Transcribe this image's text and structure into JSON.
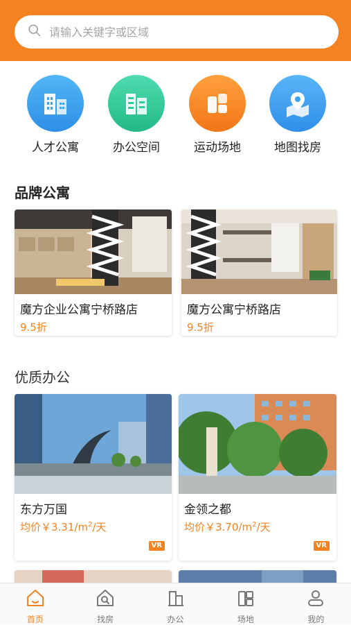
{
  "search": {
    "placeholder": "请输入关键字或区域"
  },
  "categories": [
    {
      "label": "人才公寓",
      "icon": "apartment-building-icon",
      "color": "#3ba4ee"
    },
    {
      "label": "办公空间",
      "icon": "office-building-icon",
      "color": "#2ecc9a"
    },
    {
      "label": "运动场地",
      "icon": "sports-venue-icon",
      "color": "#f58220"
    },
    {
      "label": "地图找房",
      "icon": "map-pin-icon",
      "color": "#3b9ff0"
    }
  ],
  "brand_section": {
    "title": "品牌公寓",
    "cards": [
      {
        "name": "魔方企业公寓宁桥路店",
        "price": "9.5折"
      },
      {
        "name": "魔方公寓宁桥路店",
        "price": "9.5折"
      }
    ]
  },
  "office_section": {
    "title": "优质办公",
    "cards": [
      {
        "name": "东方万国",
        "price_prefix": "均价￥3.31/m",
        "price_sup": "2",
        "price_suffix": "/天",
        "badge": "VR"
      },
      {
        "name": "金领之都",
        "price_prefix": "均价￥3.70/m",
        "price_sup": "2",
        "price_suffix": "/天",
        "badge": "VR"
      }
    ]
  },
  "bottom_nav": [
    {
      "label": "首页",
      "icon": "home-icon",
      "active": true
    },
    {
      "label": "找房",
      "icon": "find-house-icon",
      "active": false
    },
    {
      "label": "办公",
      "icon": "office-icon",
      "active": false
    },
    {
      "label": "场地",
      "icon": "venue-icon",
      "active": false
    },
    {
      "label": "我的",
      "icon": "profile-icon",
      "active": false
    }
  ],
  "colors": {
    "accent": "#f58220",
    "text": "#222222",
    "muted": "#a4a4a4"
  }
}
